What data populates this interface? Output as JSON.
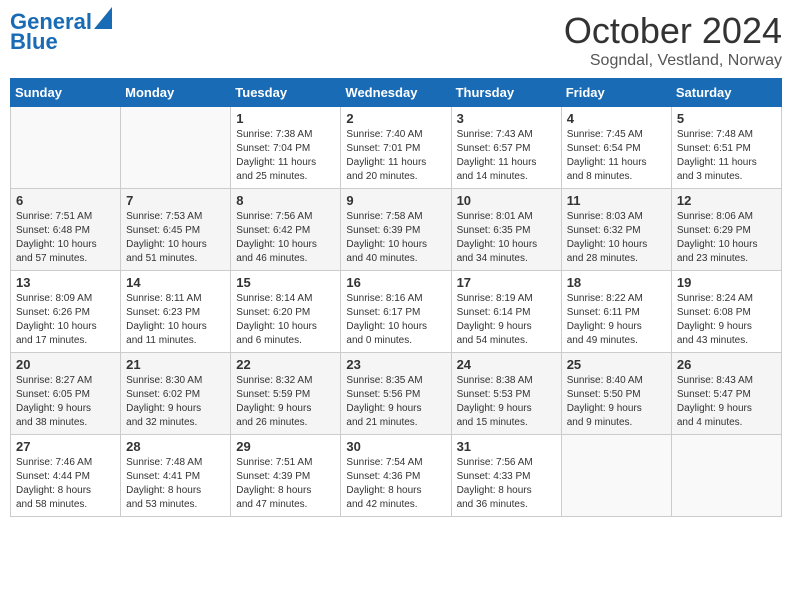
{
  "header": {
    "logo_line1": "General",
    "logo_line2": "Blue",
    "month_title": "October 2024",
    "location": "Sogndal, Vestland, Norway"
  },
  "days_of_week": [
    "Sunday",
    "Monday",
    "Tuesday",
    "Wednesday",
    "Thursday",
    "Friday",
    "Saturday"
  ],
  "weeks": [
    [
      {
        "day": "",
        "info": ""
      },
      {
        "day": "",
        "info": ""
      },
      {
        "day": "1",
        "info": "Sunrise: 7:38 AM\nSunset: 7:04 PM\nDaylight: 11 hours\nand 25 minutes."
      },
      {
        "day": "2",
        "info": "Sunrise: 7:40 AM\nSunset: 7:01 PM\nDaylight: 11 hours\nand 20 minutes."
      },
      {
        "day": "3",
        "info": "Sunrise: 7:43 AM\nSunset: 6:57 PM\nDaylight: 11 hours\nand 14 minutes."
      },
      {
        "day": "4",
        "info": "Sunrise: 7:45 AM\nSunset: 6:54 PM\nDaylight: 11 hours\nand 8 minutes."
      },
      {
        "day": "5",
        "info": "Sunrise: 7:48 AM\nSunset: 6:51 PM\nDaylight: 11 hours\nand 3 minutes."
      }
    ],
    [
      {
        "day": "6",
        "info": "Sunrise: 7:51 AM\nSunset: 6:48 PM\nDaylight: 10 hours\nand 57 minutes."
      },
      {
        "day": "7",
        "info": "Sunrise: 7:53 AM\nSunset: 6:45 PM\nDaylight: 10 hours\nand 51 minutes."
      },
      {
        "day": "8",
        "info": "Sunrise: 7:56 AM\nSunset: 6:42 PM\nDaylight: 10 hours\nand 46 minutes."
      },
      {
        "day": "9",
        "info": "Sunrise: 7:58 AM\nSunset: 6:39 PM\nDaylight: 10 hours\nand 40 minutes."
      },
      {
        "day": "10",
        "info": "Sunrise: 8:01 AM\nSunset: 6:35 PM\nDaylight: 10 hours\nand 34 minutes."
      },
      {
        "day": "11",
        "info": "Sunrise: 8:03 AM\nSunset: 6:32 PM\nDaylight: 10 hours\nand 28 minutes."
      },
      {
        "day": "12",
        "info": "Sunrise: 8:06 AM\nSunset: 6:29 PM\nDaylight: 10 hours\nand 23 minutes."
      }
    ],
    [
      {
        "day": "13",
        "info": "Sunrise: 8:09 AM\nSunset: 6:26 PM\nDaylight: 10 hours\nand 17 minutes."
      },
      {
        "day": "14",
        "info": "Sunrise: 8:11 AM\nSunset: 6:23 PM\nDaylight: 10 hours\nand 11 minutes."
      },
      {
        "day": "15",
        "info": "Sunrise: 8:14 AM\nSunset: 6:20 PM\nDaylight: 10 hours\nand 6 minutes."
      },
      {
        "day": "16",
        "info": "Sunrise: 8:16 AM\nSunset: 6:17 PM\nDaylight: 10 hours\nand 0 minutes."
      },
      {
        "day": "17",
        "info": "Sunrise: 8:19 AM\nSunset: 6:14 PM\nDaylight: 9 hours\nand 54 minutes."
      },
      {
        "day": "18",
        "info": "Sunrise: 8:22 AM\nSunset: 6:11 PM\nDaylight: 9 hours\nand 49 minutes."
      },
      {
        "day": "19",
        "info": "Sunrise: 8:24 AM\nSunset: 6:08 PM\nDaylight: 9 hours\nand 43 minutes."
      }
    ],
    [
      {
        "day": "20",
        "info": "Sunrise: 8:27 AM\nSunset: 6:05 PM\nDaylight: 9 hours\nand 38 minutes."
      },
      {
        "day": "21",
        "info": "Sunrise: 8:30 AM\nSunset: 6:02 PM\nDaylight: 9 hours\nand 32 minutes."
      },
      {
        "day": "22",
        "info": "Sunrise: 8:32 AM\nSunset: 5:59 PM\nDaylight: 9 hours\nand 26 minutes."
      },
      {
        "day": "23",
        "info": "Sunrise: 8:35 AM\nSunset: 5:56 PM\nDaylight: 9 hours\nand 21 minutes."
      },
      {
        "day": "24",
        "info": "Sunrise: 8:38 AM\nSunset: 5:53 PM\nDaylight: 9 hours\nand 15 minutes."
      },
      {
        "day": "25",
        "info": "Sunrise: 8:40 AM\nSunset: 5:50 PM\nDaylight: 9 hours\nand 9 minutes."
      },
      {
        "day": "26",
        "info": "Sunrise: 8:43 AM\nSunset: 5:47 PM\nDaylight: 9 hours\nand 4 minutes."
      }
    ],
    [
      {
        "day": "27",
        "info": "Sunrise: 7:46 AM\nSunset: 4:44 PM\nDaylight: 8 hours\nand 58 minutes."
      },
      {
        "day": "28",
        "info": "Sunrise: 7:48 AM\nSunset: 4:41 PM\nDaylight: 8 hours\nand 53 minutes."
      },
      {
        "day": "29",
        "info": "Sunrise: 7:51 AM\nSunset: 4:39 PM\nDaylight: 8 hours\nand 47 minutes."
      },
      {
        "day": "30",
        "info": "Sunrise: 7:54 AM\nSunset: 4:36 PM\nDaylight: 8 hours\nand 42 minutes."
      },
      {
        "day": "31",
        "info": "Sunrise: 7:56 AM\nSunset: 4:33 PM\nDaylight: 8 hours\nand 36 minutes."
      },
      {
        "day": "",
        "info": ""
      },
      {
        "day": "",
        "info": ""
      }
    ]
  ]
}
